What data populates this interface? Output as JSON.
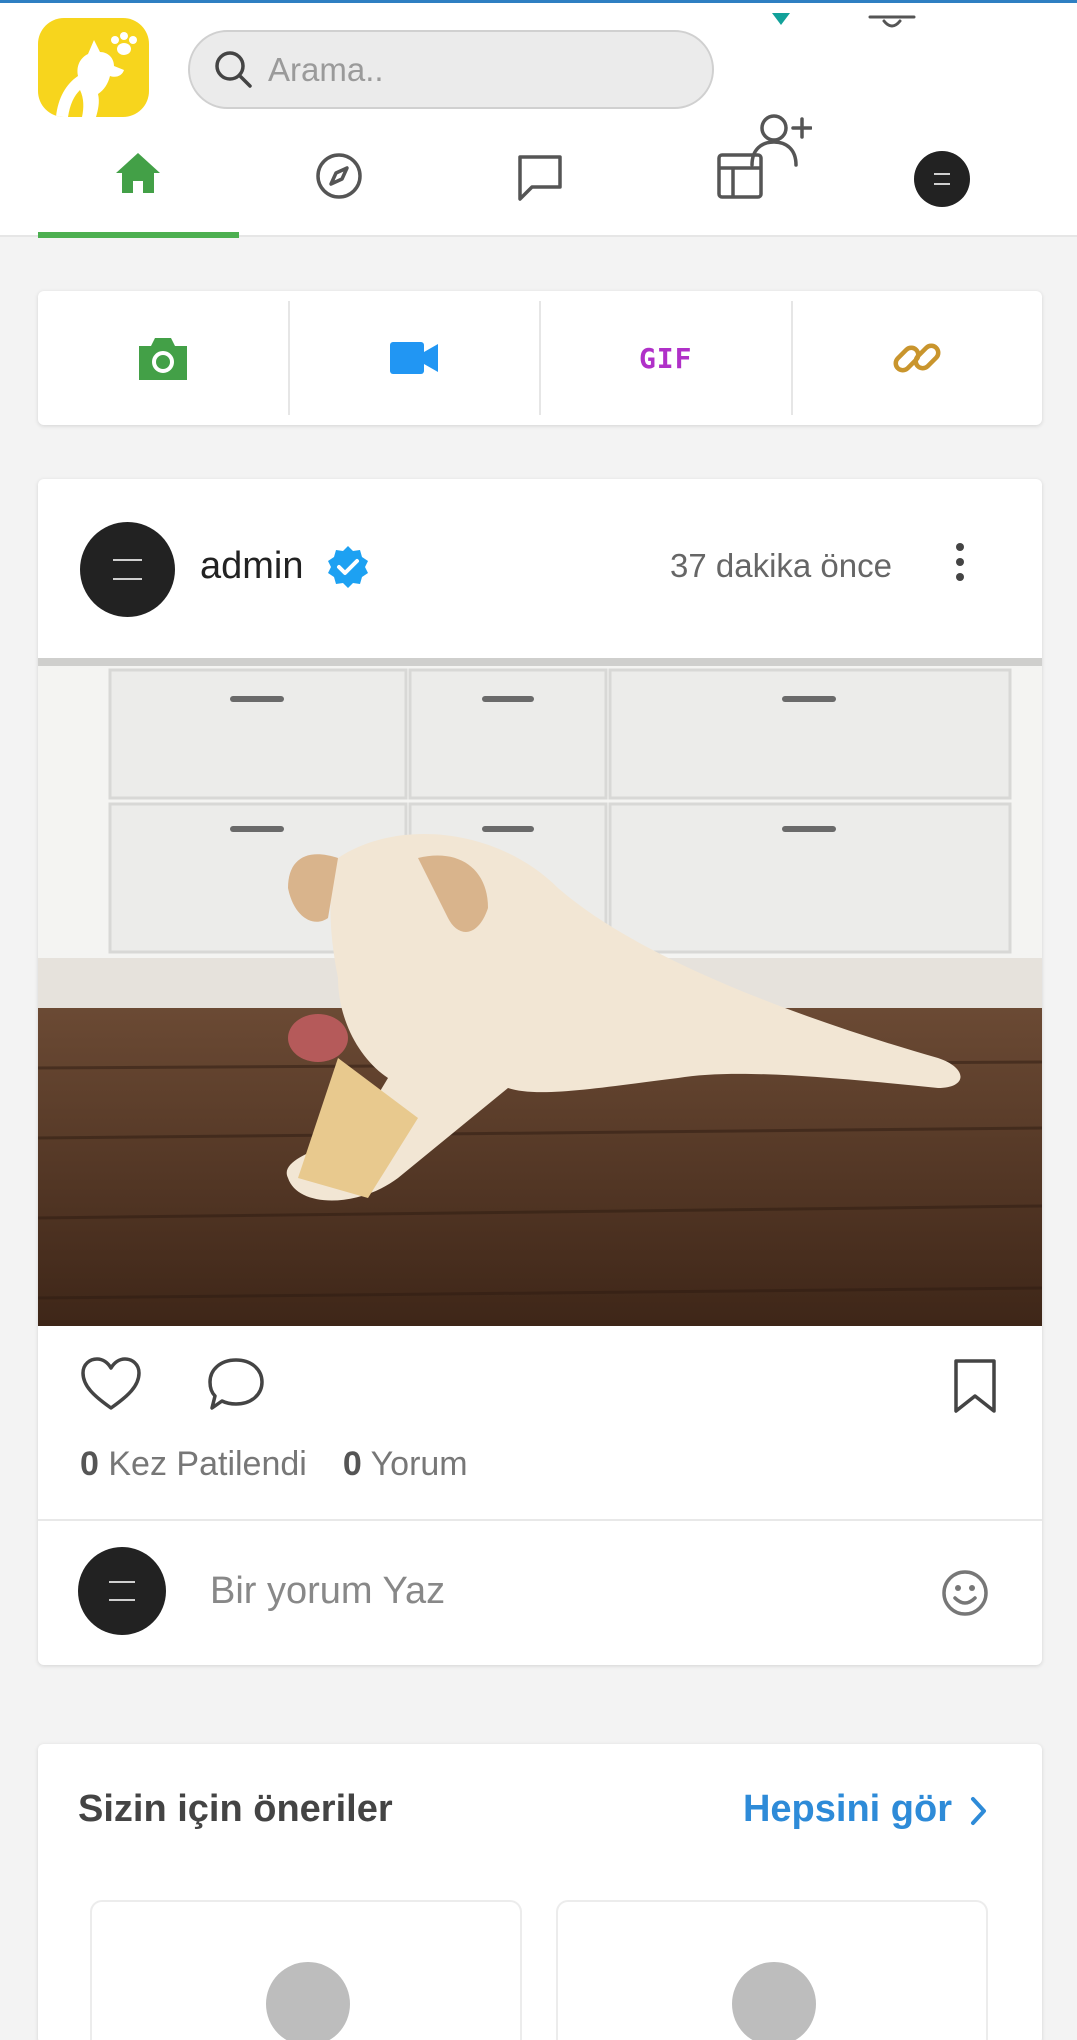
{
  "search": {
    "placeholder": "Arama.."
  },
  "nav": {
    "items": [
      {
        "name": "home",
        "icon": "home-icon",
        "active": true
      },
      {
        "name": "explore",
        "icon": "compass-icon",
        "active": false
      },
      {
        "name": "messages",
        "icon": "chat-bubble-icon",
        "active": false
      },
      {
        "name": "dashboard",
        "icon": "layout-icon",
        "active": false
      },
      {
        "name": "profile",
        "icon": "avatar",
        "active": false
      }
    ]
  },
  "composer": {
    "buttons": [
      {
        "name": "photo",
        "icon": "camera-icon",
        "color": "#43a047"
      },
      {
        "name": "video",
        "icon": "video-camera-icon",
        "color": "#2196f3"
      },
      {
        "name": "gif",
        "label": "GIF",
        "color": "#b030c8"
      },
      {
        "name": "link",
        "icon": "link-icon",
        "color": "#c9952d"
      }
    ]
  },
  "post": {
    "username": "admin",
    "verified": true,
    "time": "37 dakika önce",
    "likes_count": "0",
    "likes_label": "Kez Patilendi",
    "comments_count": "0",
    "comments_label": "Yorum",
    "comment_placeholder": "Bir yorum Yaz"
  },
  "suggestions": {
    "title": "Sizin için öneriler",
    "see_all": "Hepsini gör"
  },
  "colors": {
    "accent_green": "#4caf50",
    "link_blue": "#2e8bd8",
    "logo_yellow": "#f7d51d",
    "verified_blue": "#1da1f2"
  }
}
